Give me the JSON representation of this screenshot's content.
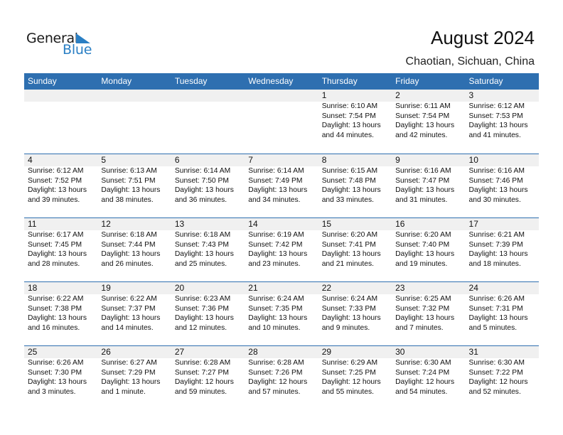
{
  "logo": {
    "word1": "General",
    "word2": "Blue",
    "brand_color": "#2a7fc4"
  },
  "header": {
    "title": "August 2024",
    "location": "Chaotian, Sichuan, China"
  },
  "colors": {
    "header_bar": "#2e6fb0",
    "date_band": "#f0f0f0"
  },
  "weekdays": [
    "Sunday",
    "Monday",
    "Tuesday",
    "Wednesday",
    "Thursday",
    "Friday",
    "Saturday"
  ],
  "weeks": [
    [
      null,
      null,
      null,
      null,
      {
        "day": "1",
        "sunrise": "Sunrise: 6:10 AM",
        "sunset": "Sunset: 7:54 PM",
        "daylight1": "Daylight: 13 hours",
        "daylight2": "and 44 minutes."
      },
      {
        "day": "2",
        "sunrise": "Sunrise: 6:11 AM",
        "sunset": "Sunset: 7:54 PM",
        "daylight1": "Daylight: 13 hours",
        "daylight2": "and 42 minutes."
      },
      {
        "day": "3",
        "sunrise": "Sunrise: 6:12 AM",
        "sunset": "Sunset: 7:53 PM",
        "daylight1": "Daylight: 13 hours",
        "daylight2": "and 41 minutes."
      }
    ],
    [
      {
        "day": "4",
        "sunrise": "Sunrise: 6:12 AM",
        "sunset": "Sunset: 7:52 PM",
        "daylight1": "Daylight: 13 hours",
        "daylight2": "and 39 minutes."
      },
      {
        "day": "5",
        "sunrise": "Sunrise: 6:13 AM",
        "sunset": "Sunset: 7:51 PM",
        "daylight1": "Daylight: 13 hours",
        "daylight2": "and 38 minutes."
      },
      {
        "day": "6",
        "sunrise": "Sunrise: 6:14 AM",
        "sunset": "Sunset: 7:50 PM",
        "daylight1": "Daylight: 13 hours",
        "daylight2": "and 36 minutes."
      },
      {
        "day": "7",
        "sunrise": "Sunrise: 6:14 AM",
        "sunset": "Sunset: 7:49 PM",
        "daylight1": "Daylight: 13 hours",
        "daylight2": "and 34 minutes."
      },
      {
        "day": "8",
        "sunrise": "Sunrise: 6:15 AM",
        "sunset": "Sunset: 7:48 PM",
        "daylight1": "Daylight: 13 hours",
        "daylight2": "and 33 minutes."
      },
      {
        "day": "9",
        "sunrise": "Sunrise: 6:16 AM",
        "sunset": "Sunset: 7:47 PM",
        "daylight1": "Daylight: 13 hours",
        "daylight2": "and 31 minutes."
      },
      {
        "day": "10",
        "sunrise": "Sunrise: 6:16 AM",
        "sunset": "Sunset: 7:46 PM",
        "daylight1": "Daylight: 13 hours",
        "daylight2": "and 30 minutes."
      }
    ],
    [
      {
        "day": "11",
        "sunrise": "Sunrise: 6:17 AM",
        "sunset": "Sunset: 7:45 PM",
        "daylight1": "Daylight: 13 hours",
        "daylight2": "and 28 minutes."
      },
      {
        "day": "12",
        "sunrise": "Sunrise: 6:18 AM",
        "sunset": "Sunset: 7:44 PM",
        "daylight1": "Daylight: 13 hours",
        "daylight2": "and 26 minutes."
      },
      {
        "day": "13",
        "sunrise": "Sunrise: 6:18 AM",
        "sunset": "Sunset: 7:43 PM",
        "daylight1": "Daylight: 13 hours",
        "daylight2": "and 25 minutes."
      },
      {
        "day": "14",
        "sunrise": "Sunrise: 6:19 AM",
        "sunset": "Sunset: 7:42 PM",
        "daylight1": "Daylight: 13 hours",
        "daylight2": "and 23 minutes."
      },
      {
        "day": "15",
        "sunrise": "Sunrise: 6:20 AM",
        "sunset": "Sunset: 7:41 PM",
        "daylight1": "Daylight: 13 hours",
        "daylight2": "and 21 minutes."
      },
      {
        "day": "16",
        "sunrise": "Sunrise: 6:20 AM",
        "sunset": "Sunset: 7:40 PM",
        "daylight1": "Daylight: 13 hours",
        "daylight2": "and 19 minutes."
      },
      {
        "day": "17",
        "sunrise": "Sunrise: 6:21 AM",
        "sunset": "Sunset: 7:39 PM",
        "daylight1": "Daylight: 13 hours",
        "daylight2": "and 18 minutes."
      }
    ],
    [
      {
        "day": "18",
        "sunrise": "Sunrise: 6:22 AM",
        "sunset": "Sunset: 7:38 PM",
        "daylight1": "Daylight: 13 hours",
        "daylight2": "and 16 minutes."
      },
      {
        "day": "19",
        "sunrise": "Sunrise: 6:22 AM",
        "sunset": "Sunset: 7:37 PM",
        "daylight1": "Daylight: 13 hours",
        "daylight2": "and 14 minutes."
      },
      {
        "day": "20",
        "sunrise": "Sunrise: 6:23 AM",
        "sunset": "Sunset: 7:36 PM",
        "daylight1": "Daylight: 13 hours",
        "daylight2": "and 12 minutes."
      },
      {
        "day": "21",
        "sunrise": "Sunrise: 6:24 AM",
        "sunset": "Sunset: 7:35 PM",
        "daylight1": "Daylight: 13 hours",
        "daylight2": "and 10 minutes."
      },
      {
        "day": "22",
        "sunrise": "Sunrise: 6:24 AM",
        "sunset": "Sunset: 7:33 PM",
        "daylight1": "Daylight: 13 hours",
        "daylight2": "and 9 minutes."
      },
      {
        "day": "23",
        "sunrise": "Sunrise: 6:25 AM",
        "sunset": "Sunset: 7:32 PM",
        "daylight1": "Daylight: 13 hours",
        "daylight2": "and 7 minutes."
      },
      {
        "day": "24",
        "sunrise": "Sunrise: 6:26 AM",
        "sunset": "Sunset: 7:31 PM",
        "daylight1": "Daylight: 13 hours",
        "daylight2": "and 5 minutes."
      }
    ],
    [
      {
        "day": "25",
        "sunrise": "Sunrise: 6:26 AM",
        "sunset": "Sunset: 7:30 PM",
        "daylight1": "Daylight: 13 hours",
        "daylight2": "and 3 minutes."
      },
      {
        "day": "26",
        "sunrise": "Sunrise: 6:27 AM",
        "sunset": "Sunset: 7:29 PM",
        "daylight1": "Daylight: 13 hours",
        "daylight2": "and 1 minute."
      },
      {
        "day": "27",
        "sunrise": "Sunrise: 6:28 AM",
        "sunset": "Sunset: 7:27 PM",
        "daylight1": "Daylight: 12 hours",
        "daylight2": "and 59 minutes."
      },
      {
        "day": "28",
        "sunrise": "Sunrise: 6:28 AM",
        "sunset": "Sunset: 7:26 PM",
        "daylight1": "Daylight: 12 hours",
        "daylight2": "and 57 minutes."
      },
      {
        "day": "29",
        "sunrise": "Sunrise: 6:29 AM",
        "sunset": "Sunset: 7:25 PM",
        "daylight1": "Daylight: 12 hours",
        "daylight2": "and 55 minutes."
      },
      {
        "day": "30",
        "sunrise": "Sunrise: 6:30 AM",
        "sunset": "Sunset: 7:24 PM",
        "daylight1": "Daylight: 12 hours",
        "daylight2": "and 54 minutes."
      },
      {
        "day": "31",
        "sunrise": "Sunrise: 6:30 AM",
        "sunset": "Sunset: 7:22 PM",
        "daylight1": "Daylight: 12 hours",
        "daylight2": "and 52 minutes."
      }
    ]
  ]
}
